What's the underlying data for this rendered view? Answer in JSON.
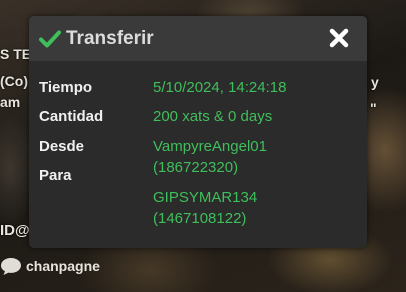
{
  "background": {
    "fragments": [
      "S TEI",
      "(Co)",
      "am",
      "ID@",
      "y",
      "\""
    ],
    "chat_label": "chanpagne"
  },
  "dialog": {
    "title": "Transferir",
    "rows": [
      {
        "label": "Tiempo",
        "value": "5/10/2024, 14:24:18"
      },
      {
        "label": "Cantidad",
        "value": "200 xats & 0 days"
      },
      {
        "label": "Desde",
        "value_line1": "VampyreAngel01",
        "value_line2": "(186722320)"
      },
      {
        "label": "Para",
        "value_line1": "GIPSYMAR134",
        "value_line2": "(1467108122)"
      }
    ]
  },
  "colors": {
    "accent_green": "#3fbf5b",
    "dialog_bg": "#2b2b2b",
    "header_bg": "#3a3a3a"
  },
  "icons": {
    "title_icon": "check-icon",
    "close": "close-icon",
    "chat": "speech-bubble-icon"
  }
}
